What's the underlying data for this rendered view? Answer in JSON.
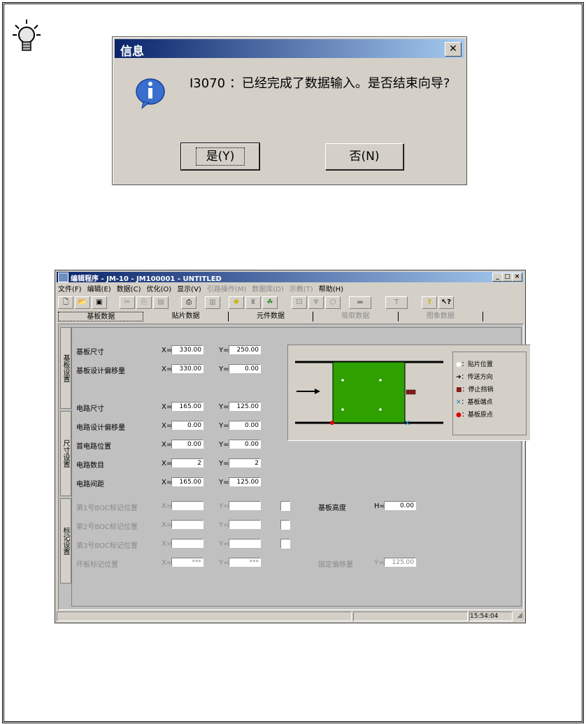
{
  "dialog": {
    "title": "信息",
    "close": "✕",
    "message": "I3070 ：已经完成了数据输入。是否结束向导?",
    "yes_label": "是(Y)",
    "no_label": "否(N)"
  },
  "app": {
    "title": "编辑程序 - JM-10 - JM100001 - UNTITLED",
    "menu": [
      "文件(F)",
      "编辑(E)",
      "数据(C)",
      "优化(O)",
      "显示(V)",
      "引路操作(M)",
      "数据库(D)",
      "示教(T)",
      "帮助(H)"
    ],
    "tabs": [
      "基板数据",
      "贴片数据",
      "元件数据",
      "吸取数据",
      "图象数据"
    ],
    "side_tabs": [
      "基板设置",
      "尺寸设置",
      "标记设置"
    ],
    "rows": [
      {
        "label": "基板尺寸",
        "x": "330.00",
        "y": "250.00"
      },
      {
        "label": "基板设计偏移量",
        "x": "330.00",
        "y": "0.00"
      },
      {
        "label": "电路尺寸",
        "x": "165.00",
        "y": "125.00"
      },
      {
        "label": "电路设计偏移量",
        "x": "0.00",
        "y": "0.00"
      },
      {
        "label": "首电路位置",
        "x": "0.00",
        "y": "0.00"
      },
      {
        "label": "电路数目",
        "x": "2",
        "y": "2"
      },
      {
        "label": "电路间距",
        "x": "165.00",
        "y": "125.00"
      }
    ],
    "mark_rows": [
      {
        "label": "第1号BOC标记位置",
        "x": "",
        "y": ""
      },
      {
        "label": "第2号BOC标记位置",
        "x": "",
        "y": ""
      },
      {
        "label": "第3号BOC标记位置",
        "x": "",
        "y": ""
      },
      {
        "label": "坏板标记位置",
        "x": "***",
        "y": "***"
      }
    ],
    "board_height": {
      "label": "基板高度",
      "prefix": "H=",
      "value": "0.00"
    },
    "fixed_offset": {
      "label": "固定偏移量",
      "prefix": "Y=",
      "value": "125.00"
    },
    "prefix_x": "X=",
    "prefix_y": "Y=",
    "legend": [
      "：贴片位置",
      "：传送方向",
      "：停止挡销",
      "：基板端点",
      "：基板原点"
    ],
    "status_time": "15:54:04"
  }
}
